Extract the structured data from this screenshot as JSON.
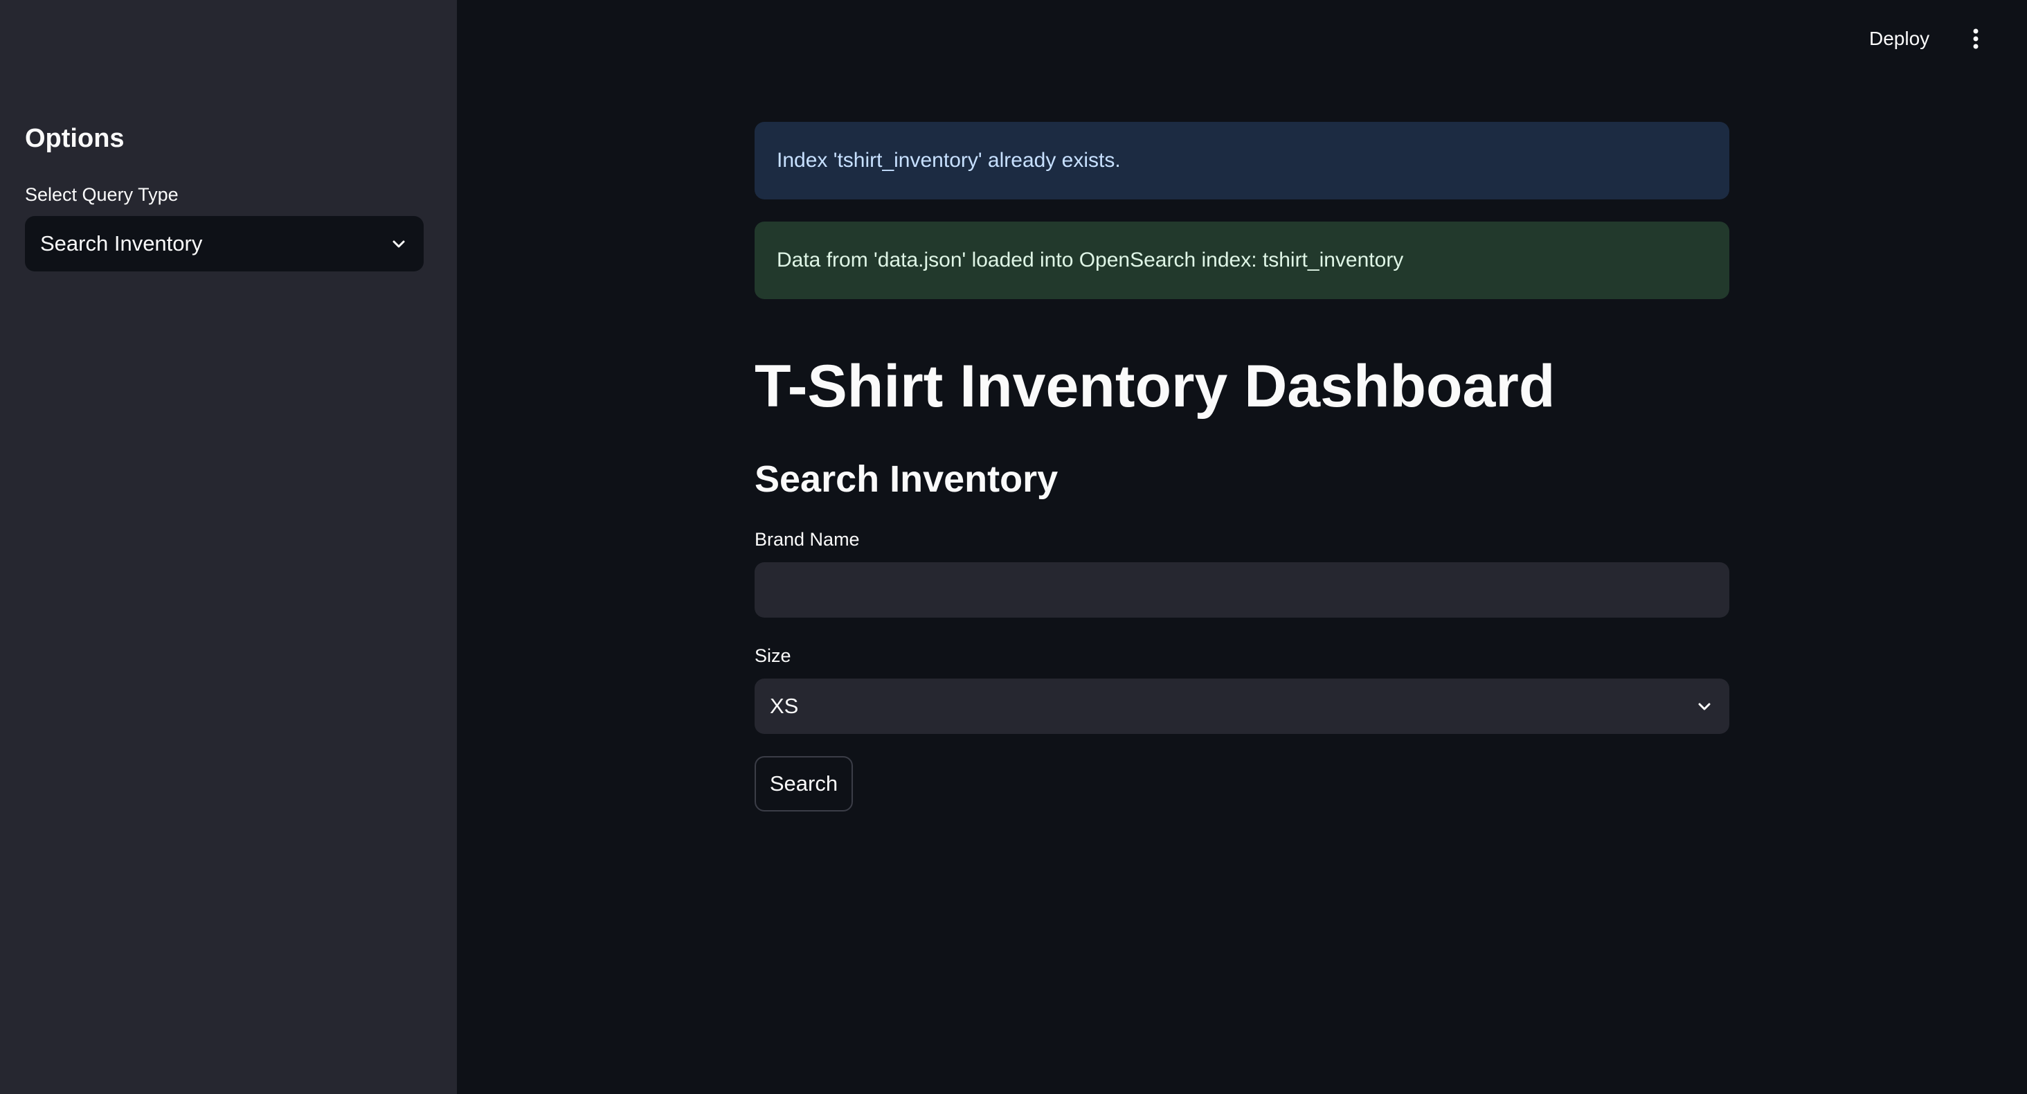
{
  "header": {
    "deploy_label": "Deploy",
    "menu_icon": "kebab-menu-icon"
  },
  "sidebar": {
    "title": "Options",
    "query_type": {
      "label": "Select Query Type",
      "selected": "Search Inventory",
      "icon": "chevron-down-icon"
    }
  },
  "main": {
    "alerts": {
      "info": "Index 'tshirt_inventory' already exists.",
      "success": "Data from 'data.json' loaded into OpenSearch index: tshirt_inventory"
    },
    "title": "T-Shirt Inventory Dashboard",
    "section_title": "Search Inventory",
    "brand_field": {
      "label": "Brand Name",
      "value": ""
    },
    "size_field": {
      "label": "Size",
      "selected": "XS",
      "icon": "chevron-down-icon"
    },
    "search_button": "Search"
  },
  "colors": {
    "background": "#0e1117",
    "sidebar": "#262730",
    "info_bg": "#1c2b42",
    "success_bg": "#22392c",
    "input_bg": "#262730"
  }
}
